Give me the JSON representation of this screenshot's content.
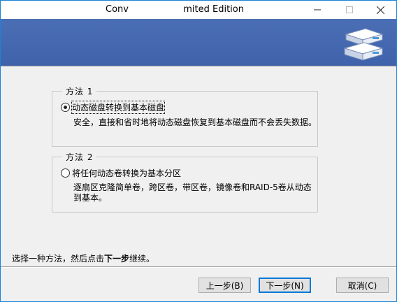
{
  "window": {
    "title_left": "Conv",
    "title_right": "mited Edition"
  },
  "group1": {
    "legend": "方法 1",
    "option_label": "动态磁盘转换到基本磁盘",
    "selected": true,
    "description": "安全，直接和省时地将动态磁盘恢复到基本磁盘而不会丢失数据。"
  },
  "group2": {
    "legend": "方法 2",
    "option_label": "将任何动态卷转换为基本分区",
    "selected": false,
    "description": "逐扇区克隆简单卷，跨区卷，带区卷，镜像卷和RAID-5卷从动态到基本。"
  },
  "instruction": {
    "prefix": "选择一种方法，然后点击",
    "bold": "下一步",
    "suffix": "继续。"
  },
  "buttons": {
    "back": "上一步(B)",
    "next": "下一步(N)",
    "cancel": "取消(C)"
  },
  "colors": {
    "banner": "#4467b0",
    "accent": "#0078d7"
  }
}
